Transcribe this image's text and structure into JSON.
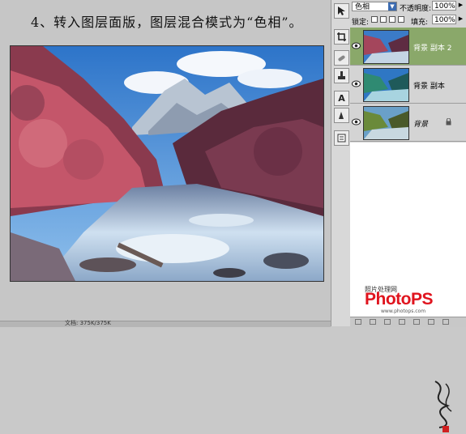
{
  "instruction": "4、转入图层面版，图层混合模式为“色相”。",
  "layers_panel": {
    "blend_mode": "色相",
    "opacity_label": "不透明度:",
    "opacity_value": "100%",
    "lock_label": "锁定:",
    "fill_label": "填充:",
    "fill_value": "100%",
    "layers": [
      {
        "name": "背景 副本 2",
        "active": true,
        "visible": true
      },
      {
        "name": "背景 副本",
        "active": false,
        "visible": true
      },
      {
        "name": "背景",
        "active": false,
        "visible": true,
        "locked": true
      }
    ]
  },
  "watermark": {
    "sub": "照片处理网",
    "brand": "PhotoPS",
    "url": "www.photops.com"
  },
  "status_text": "文档: 375K/375K",
  "colors": {
    "active_layer": "#8aa86a",
    "brand_red": "#e0141e"
  }
}
